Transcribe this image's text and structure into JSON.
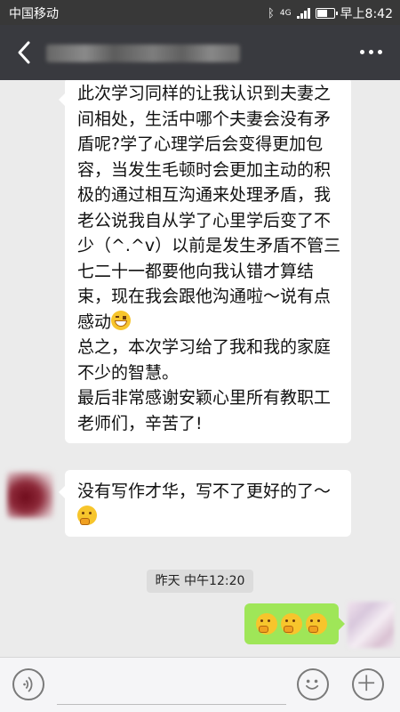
{
  "status_bar": {
    "carrier": "中国移动",
    "network": "4G",
    "time": "早上8:42"
  },
  "header": {
    "title_text": ""
  },
  "messages": [
    {
      "side": "left",
      "lines": [
        "此次学习同样的让我认识到夫妻之间相处，生活中哪个夫妻会没有矛盾呢?学了心理学后会变得更加包容，当发生毛顿时会更加主动的积极的通过相互沟通来处理矛盾，我老公说我自从学了心里学后变了不少（^.^v）以前是发生矛盾不管三七二十一都要他向我认错才算结束，现在我会跟他沟通啦～说有点感动",
        "总之，本次学习给了我和我的家庭不少的智慧。",
        "最后非常感谢安颖心里所有教职工老师们，辛苦了!"
      ]
    },
    {
      "side": "left",
      "text": "没有写作才华，写不了更好的了～"
    },
    {
      "side": "right",
      "emoji_count": 3
    }
  ],
  "timestamp": "昨天 中午12:20",
  "icons": {
    "back": "back-arrow-icon",
    "more": "more-dots-icon",
    "voice": "voice-icon",
    "emoji": "emoji-icon",
    "plus": "plus-icon"
  },
  "colors": {
    "nav": "#393a3f",
    "status": "#383838",
    "bubble_me": "#9fe658",
    "bubble_other": "#ffffff",
    "bg": "#ebebeb"
  }
}
